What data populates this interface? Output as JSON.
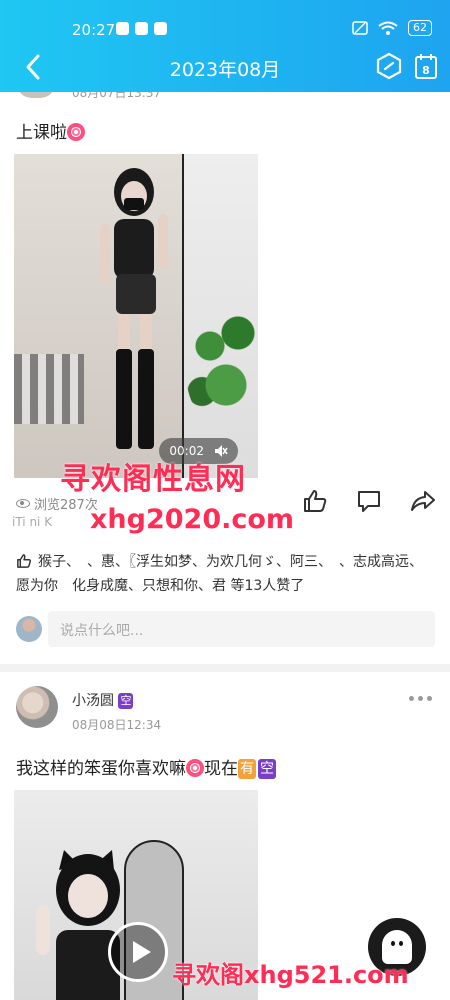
{
  "status_bar": {
    "time": "20:27",
    "battery": "62"
  },
  "nav": {
    "title": "2023年08月",
    "calendar_day": "8"
  },
  "post1": {
    "date_peek": "08月07日13:37",
    "text": "上课啦",
    "video_duration": "00:02",
    "views": "浏览287次",
    "faded_text": "iTi ni K",
    "likes": "猴子、　、惠、〖浮生如梦、为欢几何ゞ、阿三、　、志成高远、愿为你　化身成魔、只想和你、君 等13人赞了",
    "comment_placeholder": "说点什么吧..."
  },
  "post2": {
    "author": "小汤圆",
    "author_badge": "空",
    "date": "08月08日12:34",
    "text_before": "我这样的笨蛋你喜欢嘛",
    "text_after": "现在",
    "badge_have": "有",
    "badge_empty": "空"
  },
  "watermarks": {
    "line1": "寻欢阁性息网",
    "line2": "xhg2020.com",
    "line3": "寻欢阁xhg521.com"
  },
  "colors": {
    "header_start": "#1fc7f2",
    "header_end": "#1ea4f0",
    "watermark": "#ff2d55"
  }
}
